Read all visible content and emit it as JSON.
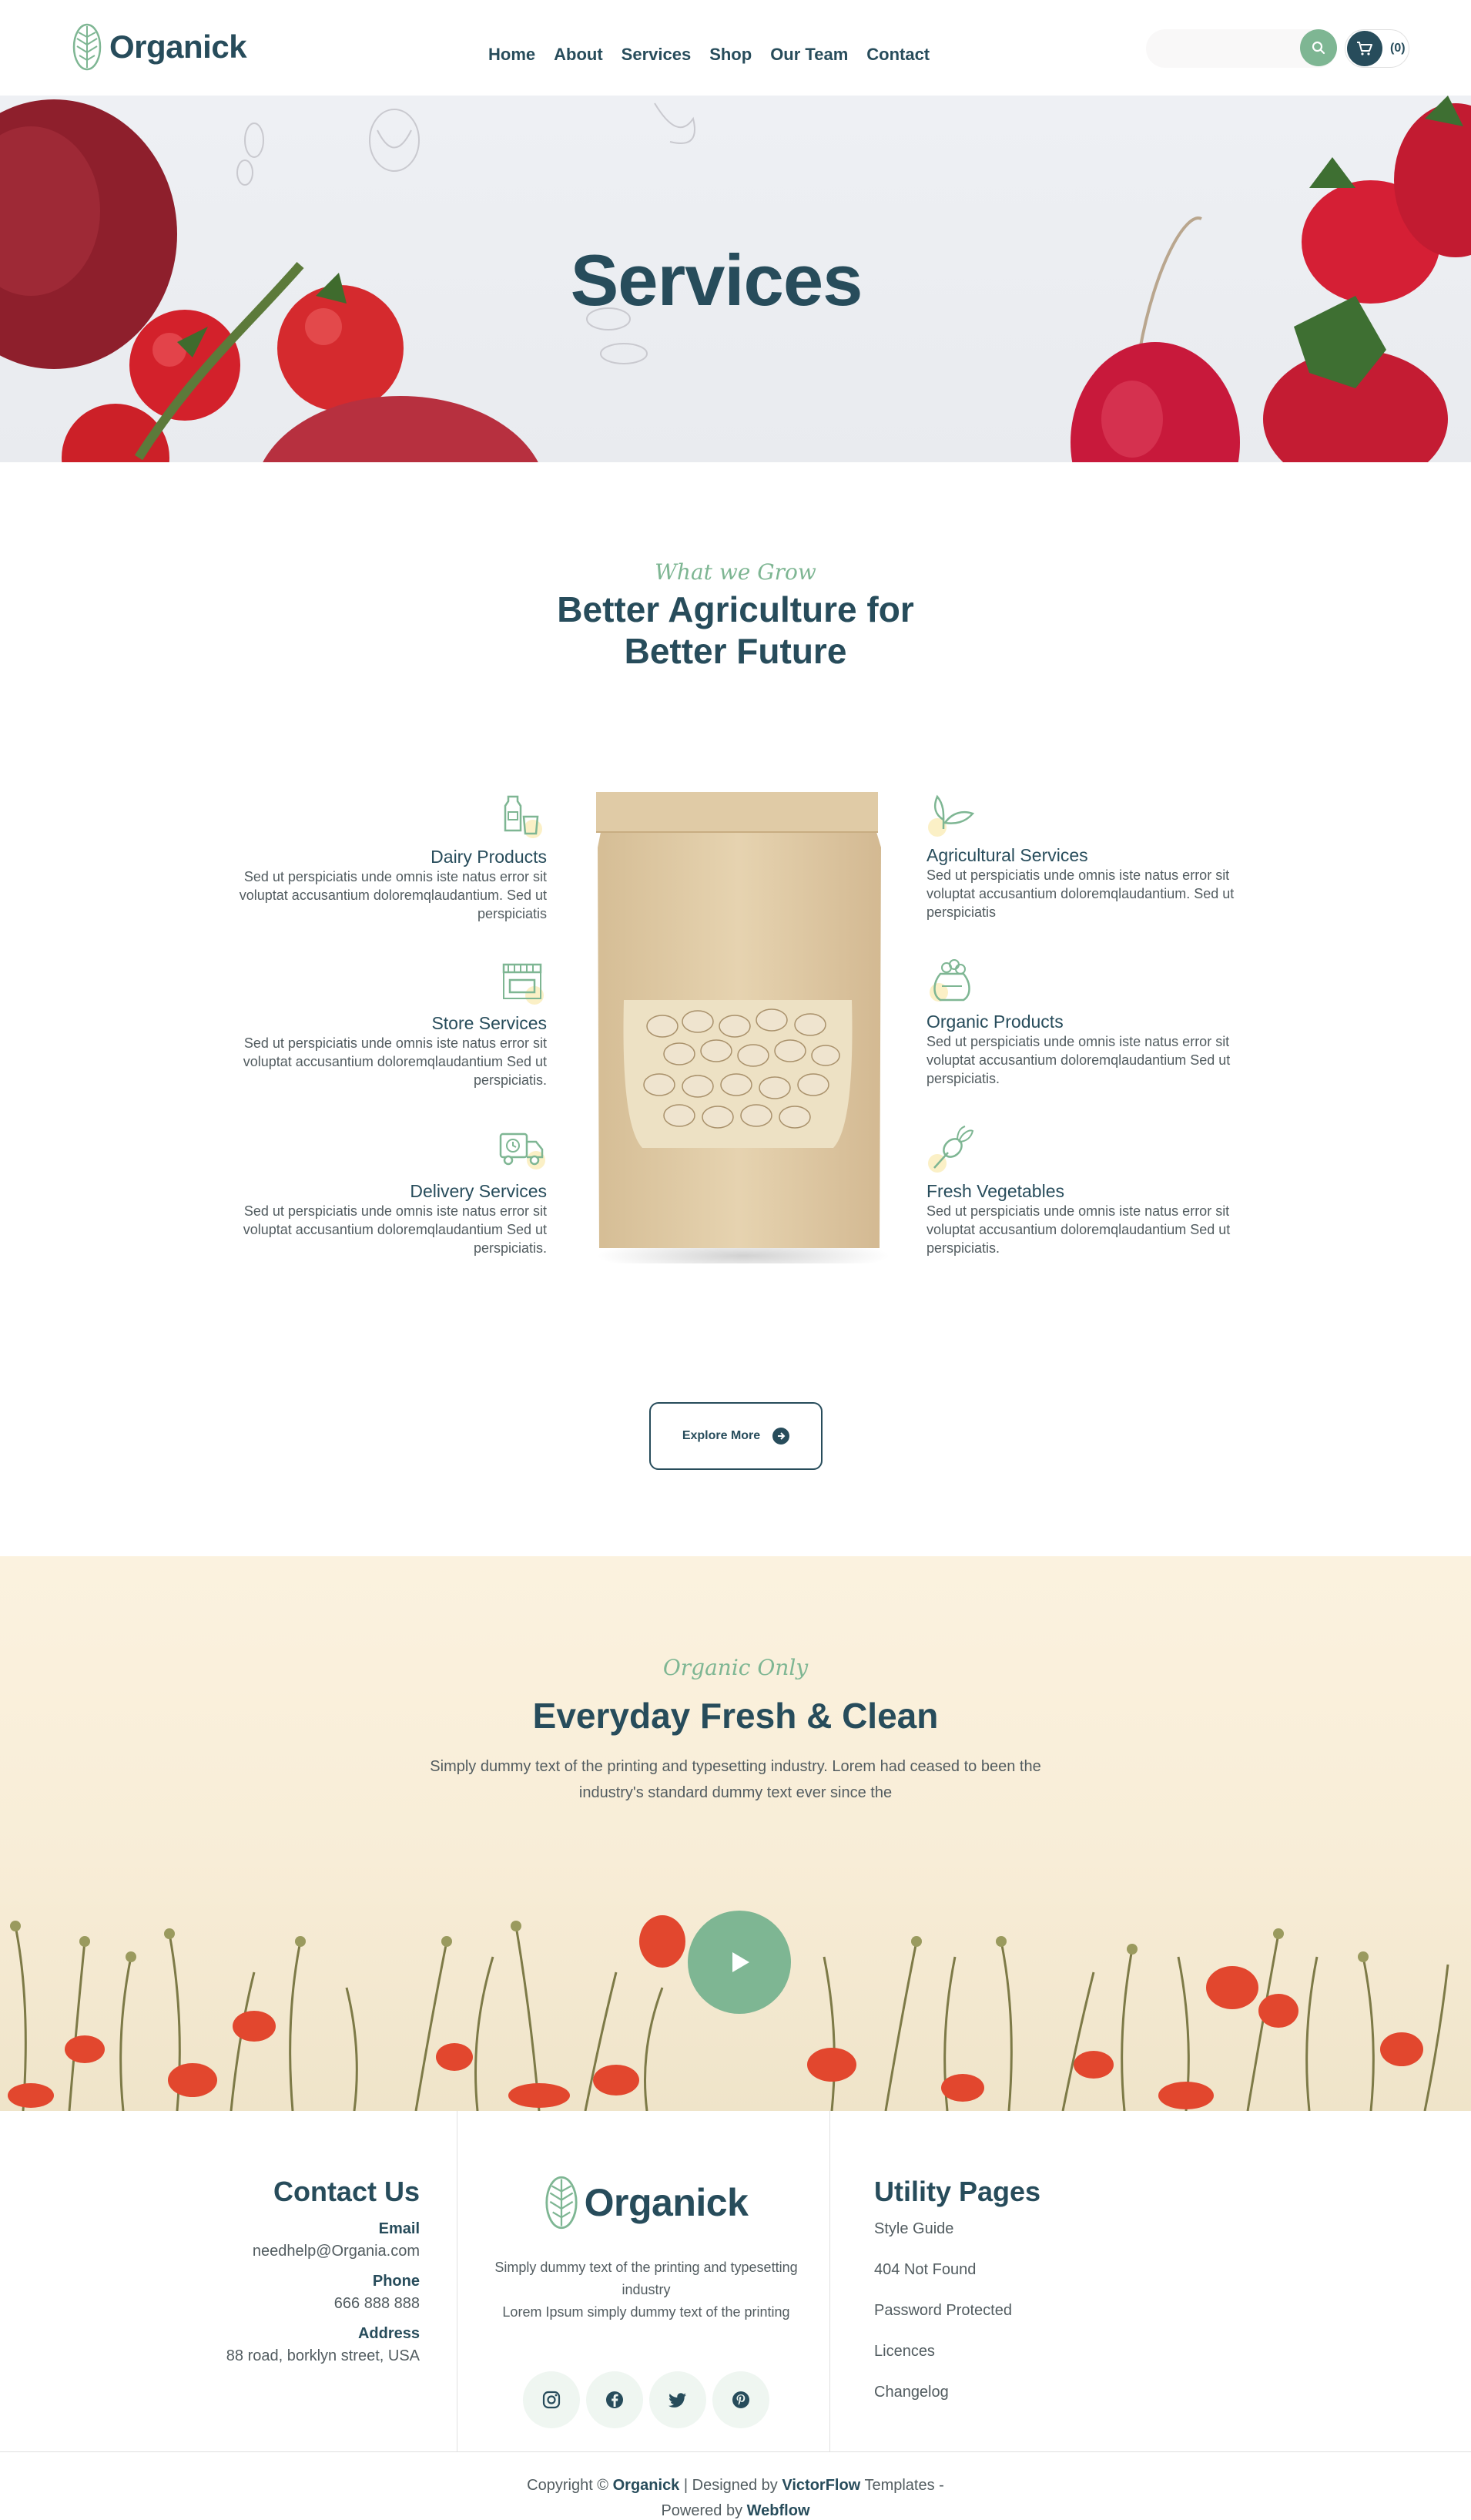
{
  "brand": {
    "name": "Organick"
  },
  "nav": [
    "Home",
    "About",
    "Services",
    "Shop",
    "Our Team",
    "Contact"
  ],
  "cart": {
    "count": "(0)"
  },
  "hero": {
    "title": "Services"
  },
  "services_section": {
    "eyebrow": "What we Grow",
    "title_line1": "Better Agriculture for",
    "title_line2": "Better Future",
    "left": [
      {
        "title": "Dairy Products",
        "desc": "Sed ut perspiciatis unde omnis iste natus error sit voluptat accusantium doloremqlaudantium. Sed ut perspiciatis",
        "icon": "milk-bottle-icon"
      },
      {
        "title": "Store Services",
        "desc": "Sed ut perspiciatis unde omnis iste natus error sit voluptat accusantium doloremqlaudantium Sed ut perspiciatis.",
        "icon": "storefront-icon"
      },
      {
        "title": "Delivery Services",
        "desc": "Sed ut perspiciatis unde omnis iste natus error sit voluptat accusantium doloremqlaudantium Sed ut perspiciatis.",
        "icon": "delivery-truck-icon"
      }
    ],
    "right": [
      {
        "title": "Agricultural Services",
        "desc": "Sed ut perspiciatis unde omnis iste natus error sit voluptat accusantium doloremqlaudantium. Sed ut perspiciatis",
        "icon": "leaf-sprout-icon"
      },
      {
        "title": "Organic Products",
        "desc": "Sed ut perspiciatis unde omnis iste natus error sit voluptat accusantium doloremqlaudantium Sed ut perspiciatis.",
        "icon": "produce-sack-icon"
      },
      {
        "title": "Fresh Vegetables",
        "desc": "Sed ut perspiciatis unde omnis iste natus error sit voluptat accusantium doloremqlaudantium Sed ut perspiciatis.",
        "icon": "radish-icon"
      }
    ],
    "button": "Explore More"
  },
  "fresh": {
    "eyebrow": "Organic Only",
    "title": "Everyday Fresh & Clean",
    "text_line1": "Simply dummy text of the printing and typesetting industry. Lorem had ceased to been the",
    "text_line2": "industry's standard dummy text ever since the"
  },
  "footer": {
    "contact": {
      "title": "Contact Us",
      "email_label": "Email",
      "email": "needhelp@Organia.com",
      "phone_label": "Phone",
      "phone": "666 888 888",
      "address_label": "Address",
      "address": "88 road, borklyn street, USA"
    },
    "middle": {
      "brand": "Organick",
      "text_line1": "Simply dummy text of the printing and typesetting industry",
      "text_line2": "Lorem Ipsum simply dummy text of the printing",
      "socials": [
        "instagram-icon",
        "facebook-icon",
        "twitter-icon",
        "pinterest-icon"
      ]
    },
    "utility": {
      "title": "Utility Pages",
      "links": [
        "Style Guide",
        "404 Not Found",
        "Password Protected",
        "Licences",
        "Changelog"
      ]
    },
    "copyright": {
      "prefix": "Copyright ©",
      "brand": "Organick",
      "mid": "| Designed by",
      "designer": "VictorFlow",
      "suffix": "Templates -",
      "powered": "Powered by",
      "platform": "Webflow"
    }
  },
  "colors": {
    "primary": "#274c5b",
    "accent": "#7eb693",
    "text": "#525c60",
    "highlight": "#efd372"
  }
}
